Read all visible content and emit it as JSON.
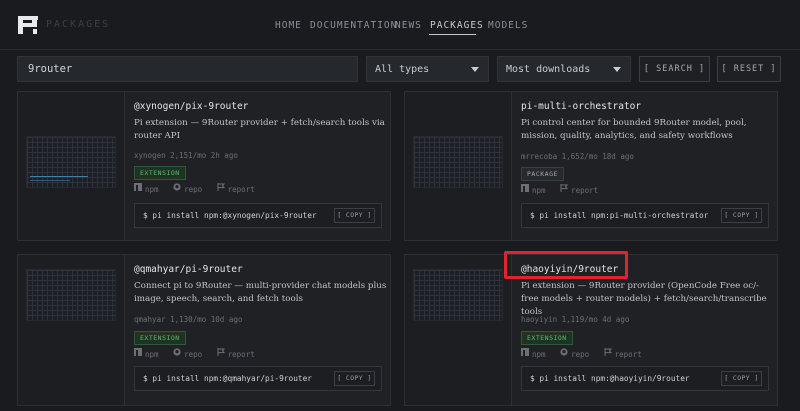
{
  "header": {
    "logo_text": "PACKAGES",
    "nav": [
      {
        "label": "HOME"
      },
      {
        "label": "DOCUMENTATION"
      },
      {
        "label": "NEWS"
      },
      {
        "label": "PACKAGES"
      },
      {
        "label": "MODELS"
      }
    ],
    "active_nav": "PACKAGES"
  },
  "filters": {
    "search_value": "9router",
    "type_select": "All types",
    "sort_select": "Most downloads",
    "search_button": "[ SEARCH ]",
    "reset_button": "[ RESET ]"
  },
  "cards": [
    {
      "title": "@xynogen/pix-9router",
      "description": "Pi extension — 9Router provider + fetch/search tools via router API",
      "meta": "xynogen  2,151/mo  2h ago",
      "badge": "EXTENSION",
      "links": [
        "npm",
        "repo",
        "report"
      ],
      "install": "$ pi install npm:@xynogen/pix-9router",
      "copy": "[ COPY ]"
    },
    {
      "title": "pi-multi-orchestrator",
      "description": "Pi control center for bounded 9Router model, pool, mission, quality, analytics, and safety workflows",
      "meta": "mrrecoba  1,652/mo  18d ago",
      "badge": "PACKAGE",
      "links": [
        "npm",
        "report"
      ],
      "install": "$ pi install npm:pi-multi-orchestrator",
      "copy": "[ COPY ]"
    },
    {
      "title": "@qmahyar/pi-9router",
      "description": "Connect pi to 9Router — multi-provider chat models plus image, speech, search, and fetch tools",
      "meta": "qmahyar  1,130/mo  10d ago",
      "badge": "EXTENSION",
      "links": [
        "npm",
        "repo",
        "report"
      ],
      "install": "$ pi install npm:@qmahyar/pi-9router",
      "copy": "[ COPY ]"
    },
    {
      "title": "@haoyiyin/9router",
      "description": "Pi extension — 9Router provider (OpenCode Free oc/-free models + router models) + fetch/search/transcribe tools",
      "meta": "haoyiyin  1,119/mo  4d ago",
      "badge": "EXTENSION",
      "links": [
        "npm",
        "repo",
        "report"
      ],
      "install": "$ pi install npm:@haoyiyin/9router",
      "copy": "[ COPY ]"
    }
  ],
  "colors": {
    "background": "#191b1f",
    "card": "#1f2125",
    "extension_badge": "#5fb872",
    "highlight": "#e0242f"
  },
  "icons": [
    "logo-icon",
    "chevron-down-icon",
    "npm-icon",
    "github-icon",
    "flag-icon"
  ]
}
